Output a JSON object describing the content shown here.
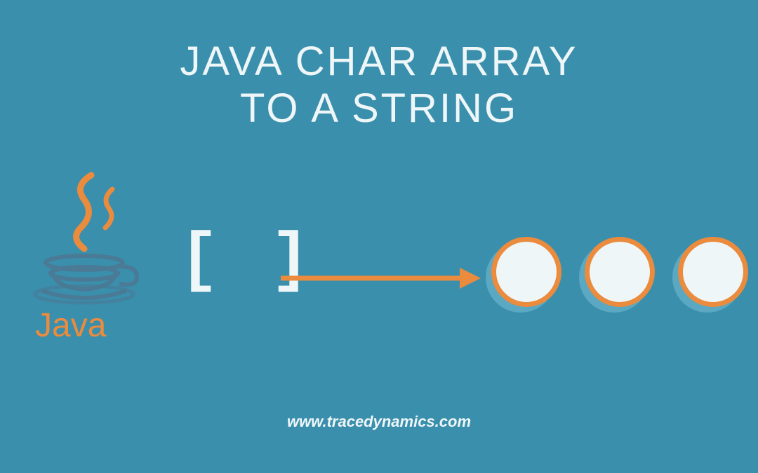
{
  "title_line1": "JAVA CHAR ARRAY",
  "title_line2": "TO A STRING",
  "brackets_text": "[ ]",
  "logo_text": "Java",
  "footer_text": "www.tracedynamics.com",
  "colors": {
    "background": "#3a8fac",
    "accent": "#ea8b3e",
    "light": "#eef6f8"
  }
}
